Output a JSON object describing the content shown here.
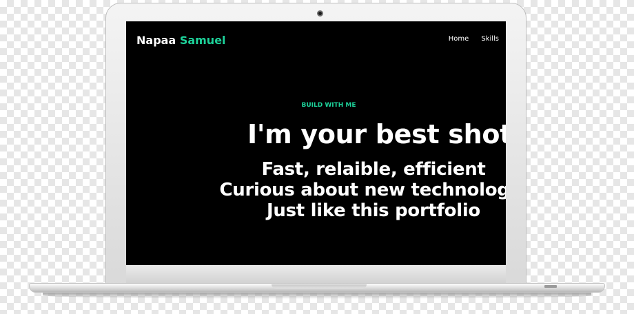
{
  "brand": {
    "first": "Napaa",
    "last": "Samuel"
  },
  "nav": {
    "items": [
      "Home",
      "Skills"
    ]
  },
  "hero": {
    "kicker": "BUILD WITH ME",
    "headline": "I'm your best shot",
    "lines": [
      "Fast, relaible, efficient",
      "Curious about new technologie",
      "Just like this portfolio"
    ]
  },
  "colors": {
    "accent": "#1dd29a",
    "screen": "#000000",
    "text": "#ffffff"
  }
}
